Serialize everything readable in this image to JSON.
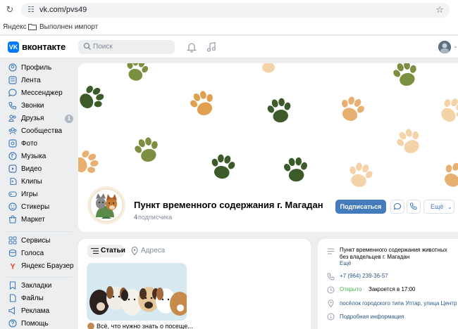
{
  "browser": {
    "url": "vk.com/pvs49",
    "bookmarks": [
      "Яндекс",
      "Выполнен импорт"
    ]
  },
  "header": {
    "brand": "вконтакте",
    "search_placeholder": "Поиск"
  },
  "sidebar": {
    "items": [
      {
        "label": "Профиль",
        "icon": "profile-icon"
      },
      {
        "label": "Лента",
        "icon": "feed-icon"
      },
      {
        "label": "Мессенджер",
        "icon": "messenger-icon"
      },
      {
        "label": "Звонки",
        "icon": "calls-icon"
      },
      {
        "label": "Друзья",
        "icon": "friends-icon",
        "badge": "1"
      },
      {
        "label": "Сообщества",
        "icon": "communities-icon"
      },
      {
        "label": "Фото",
        "icon": "photo-icon"
      },
      {
        "label": "Музыка",
        "icon": "music-icon"
      },
      {
        "label": "Видео",
        "icon": "video-icon"
      },
      {
        "label": "Клипы",
        "icon": "clips-icon"
      },
      {
        "label": "Игры",
        "icon": "games-icon"
      },
      {
        "label": "Стикеры",
        "icon": "stickers-icon"
      },
      {
        "label": "Маркет",
        "icon": "market-icon"
      }
    ],
    "items2": [
      {
        "label": "Сервисы",
        "icon": "services-icon"
      },
      {
        "label": "Голоса",
        "icon": "votes-icon"
      },
      {
        "label": "Яндекс Браузер",
        "icon": "yandex-browser-icon"
      }
    ],
    "items3": [
      {
        "label": "Закладки",
        "icon": "bookmarks-icon"
      },
      {
        "label": "Файлы",
        "icon": "files-icon"
      },
      {
        "label": "Реклама",
        "icon": "ads-icon"
      },
      {
        "label": "Помощь",
        "icon": "help-icon"
      }
    ]
  },
  "group": {
    "name": "Пункт временного содержания г. Магадан",
    "subscribers_count": "4",
    "subscribers_label": "подписчика",
    "subscribe_button": "Подписаться",
    "more_button": "Ещё"
  },
  "tabs": {
    "articles": "Статьи",
    "address": "Адреса"
  },
  "article": {
    "title": "Всё, что нужно знать о посеще..."
  },
  "info": {
    "description_line1": "Пункт временного содержания животных",
    "description_line2": "без владельцев г. Магадан",
    "more": "Ещё",
    "phone": "+7 (964) 239-36-57",
    "status_open": "Открыто",
    "status_closes": "Закроется в 17:00",
    "address": "посёлок городского типа Уптар, улица Центр",
    "details": "Подробная информация"
  },
  "colors": {
    "accent": "#0077ff",
    "button": "#447bba",
    "paw_dark": "#3d5a2a",
    "paw_olive": "#7a8f3f",
    "paw_orange": "#e0a050",
    "paw_peach": "#f5d3a8"
  }
}
